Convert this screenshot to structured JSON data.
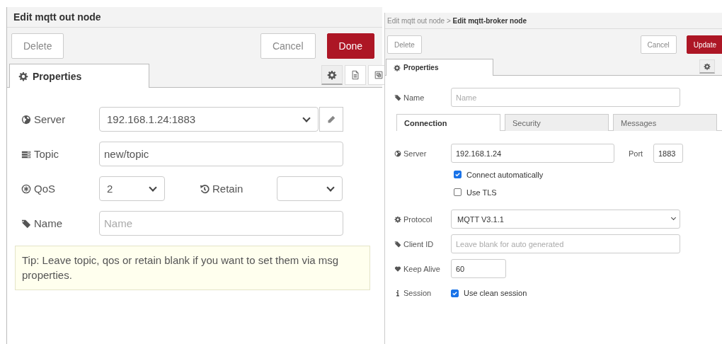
{
  "left_dialog": {
    "title": "Edit mqtt out node",
    "buttons": [
      {
        "label": "Delete",
        "kind": "plain"
      },
      {
        "label": "Cancel",
        "kind": "plain"
      },
      {
        "label": "Done",
        "kind": "primary"
      }
    ],
    "tabs": [
      {
        "label": "Properties",
        "selected": true
      }
    ],
    "tab_tools": [
      {
        "kind": "gear",
        "selected": true
      },
      {
        "kind": "file",
        "selected": false
      },
      {
        "kind": "frame",
        "selected": false
      }
    ],
    "server": {
      "label": "Server",
      "value": "192.168.1.24:1883"
    },
    "topic": {
      "label": "Topic",
      "value": "new/topic"
    },
    "qos": {
      "label": "QoS",
      "value": "2"
    },
    "retain": {
      "label": "Retain"
    },
    "name": {
      "label": "Name",
      "placeholder": "Name"
    },
    "tip": "Tip: Leave topic, qos or retain blank if you want to set them via msg properties."
  },
  "right_dialog": {
    "breadcrumb": "Edit mqtt out node > **Edit mqtt-broker node**",
    "buttons": [
      {
        "label": "Delete",
        "kind": "plain"
      },
      {
        "label": "Cancel",
        "kind": "plain"
      },
      {
        "label": "Update",
        "kind": "primary"
      }
    ],
    "tabs": [
      {
        "label": "Properties",
        "selected": true
      }
    ],
    "tab_tools": [
      {
        "kind": "gear",
        "selected": true
      }
    ],
    "name": {
      "label": "Name",
      "placeholder": "Name"
    },
    "sub_tabs": [
      {
        "label": "Connection",
        "selected": true
      },
      {
        "label": "Security",
        "selected": false
      },
      {
        "label": "Messages",
        "selected": false
      }
    ],
    "server": {
      "label": "Server",
      "value": "192.168.1.24"
    },
    "port": {
      "label": "Port",
      "value": "1883"
    },
    "options": [
      {
        "label": "Connect automatically",
        "checked": true
      },
      {
        "label": "Use TLS",
        "checked": false
      }
    ],
    "protocol": {
      "label": "Protocol",
      "value": "MQTT V3.1.1"
    },
    "client_id": {
      "label": "Client ID",
      "placeholder": "Leave blank for auto generated"
    },
    "keep_alive": {
      "label": "Keep Alive",
      "value": "60"
    },
    "session": {
      "label": "Session",
      "option": "Use clean session",
      "checked": true
    }
  }
}
